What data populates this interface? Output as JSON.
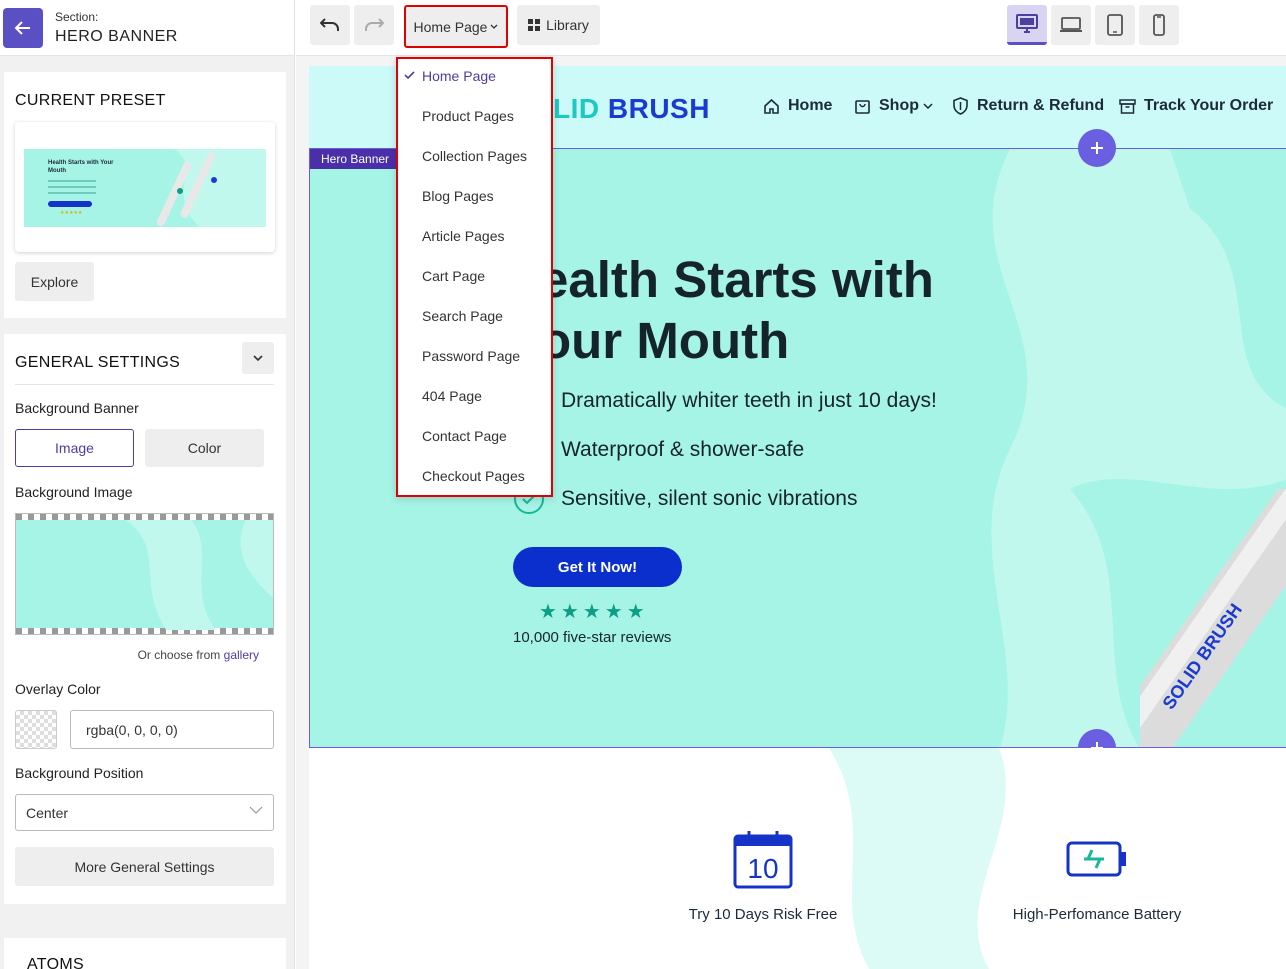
{
  "colors": {
    "accent": "#5b4fc4",
    "hero_bg": "#a6f4e6",
    "cta": "#0a2fcc",
    "highlight": "#e00000"
  },
  "sidebar": {
    "section_label": "Section:",
    "section_name": "HERO BANNER",
    "preset": {
      "title": "CURRENT PRESET",
      "thumb_title": "Health Starts with Your Mouth",
      "explore_label": "Explore"
    },
    "general": {
      "title": "GENERAL SETTINGS",
      "background_banner_label": "Background Banner",
      "banner_options": [
        "Image",
        "Color"
      ],
      "selected_banner": "Image",
      "background_image_label": "Background Image",
      "gallery_prefix": "Or choose from",
      "gallery_link": "gallery",
      "overlay_label": "Overlay Color",
      "overlay_value": "rgba(0, 0, 0, 0)",
      "position_label": "Background Position",
      "position_value": "Center",
      "more_label": "More General Settings"
    },
    "atoms_title": "ATOMS"
  },
  "toolbar": {
    "page_label": "Home Page",
    "library_label": "Library",
    "devices": [
      "desktop-icon",
      "laptop-icon",
      "tablet-icon",
      "mobile-icon"
    ],
    "active_device": "desktop"
  },
  "page_menu": {
    "items": [
      "Home Page",
      "Product Pages",
      "Collection Pages",
      "Blog Pages",
      "Article Pages",
      "Cart Page",
      "Search Page",
      "Password Page",
      "404 Page",
      "Contact Page",
      "Checkout Pages"
    ],
    "selected": "Home Page"
  },
  "site": {
    "logo_main": "LID",
    "logo_accent": "",
    "logo_brand": "BRUSH",
    "nav": {
      "home": "Home",
      "shop": "Shop",
      "return": "Return & Refund",
      "track": "Track Your Order"
    },
    "hero": {
      "section_tag": "Hero Banner",
      "title_line1": "ealth Starts with",
      "title_line2": "our Mouth",
      "bullets": [
        "Dramatically whiter teeth in just 10 days!",
        "Waterproof & shower-safe",
        "Sensitive, silent sonic vibrations"
      ],
      "cta": "Get It Now!",
      "stars": "★★★★★",
      "rating": 4.5,
      "reviews": "10,000 five-star reviews",
      "brush_text": "SOLID BRUSH"
    },
    "features": [
      {
        "icon": "calendar-icon",
        "calendar_number": "10",
        "label": "Try 10 Days Risk Free"
      },
      {
        "icon": "battery-icon",
        "label": "High-Perfomance Battery"
      }
    ]
  }
}
